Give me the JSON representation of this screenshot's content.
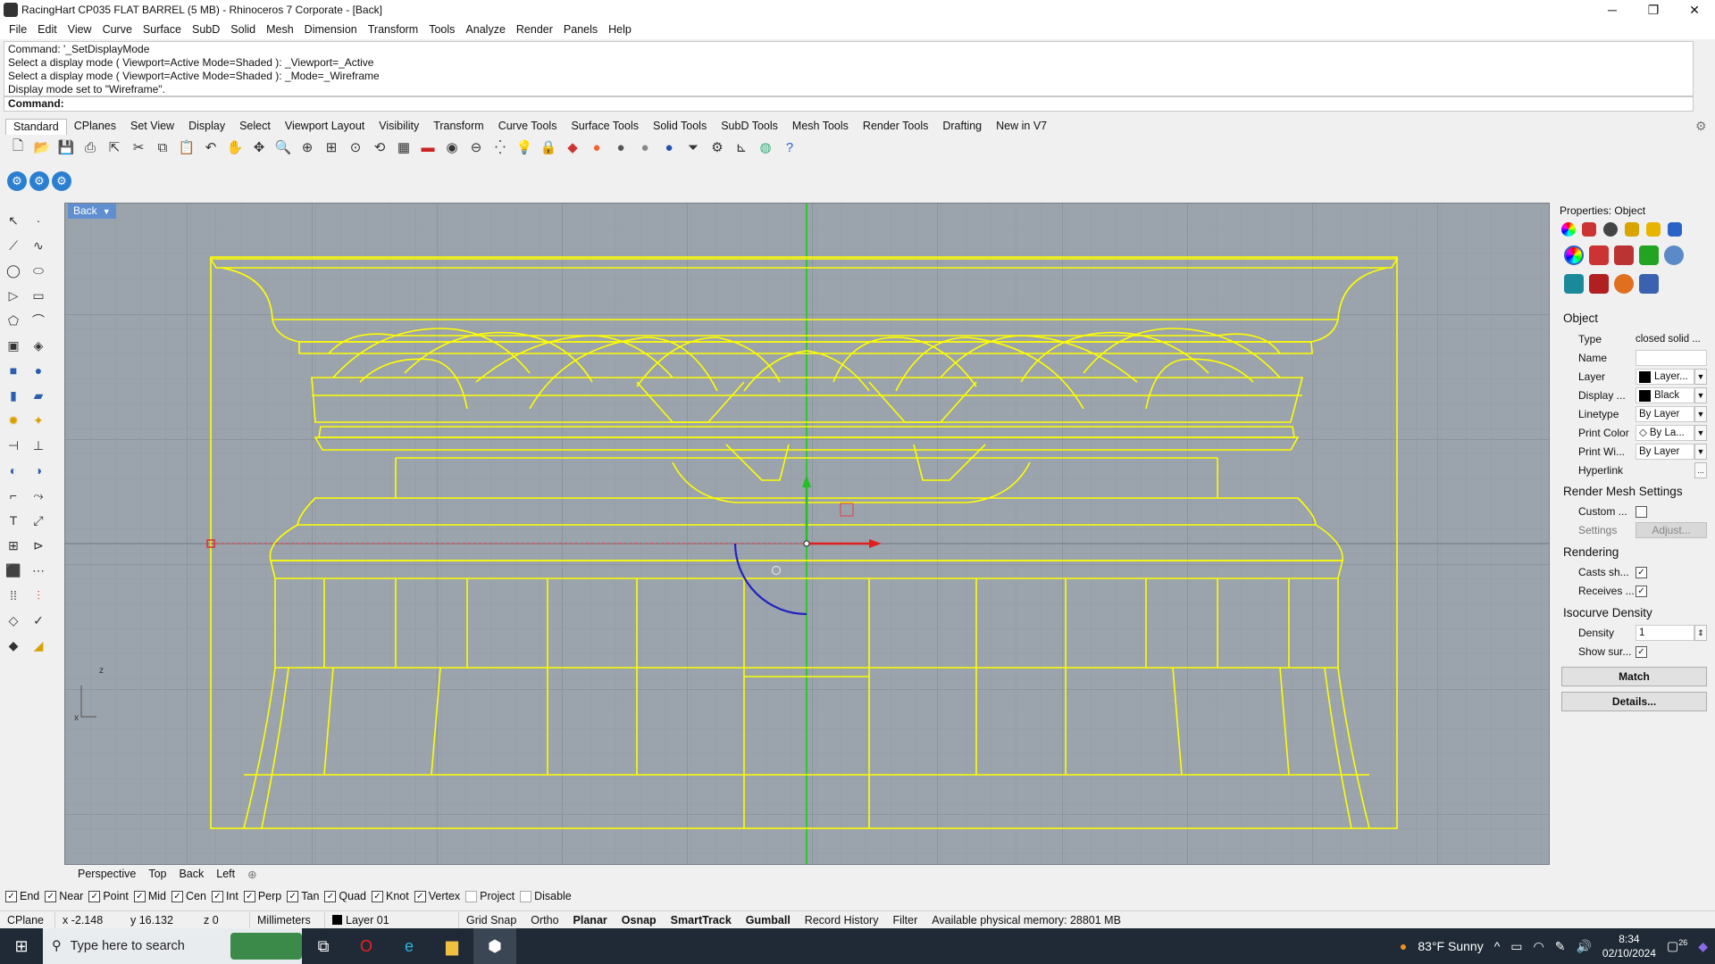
{
  "window": {
    "title": "RacingHart CP035 FLAT BARREL (5 MB) - Rhinoceros 7 Corporate - [Back]"
  },
  "menu": [
    "File",
    "Edit",
    "View",
    "Curve",
    "Surface",
    "SubD",
    "Solid",
    "Mesh",
    "Dimension",
    "Transform",
    "Tools",
    "Analyze",
    "Render",
    "Panels",
    "Help"
  ],
  "command_history": [
    "Command: '_SetDisplayMode",
    "Select a display mode ( Viewport=Active  Mode=Shaded ): _Viewport=_Active",
    "Select a display mode ( Viewport=Active  Mode=Shaded ): _Mode=_Wireframe",
    "Display mode set to \"Wireframe\"."
  ],
  "command_prompt": "Command:",
  "toolbar_tabs": [
    "Standard",
    "CPlanes",
    "Set View",
    "Display",
    "Select",
    "Viewport Layout",
    "Visibility",
    "Transform",
    "Curve Tools",
    "Surface Tools",
    "Solid Tools",
    "SubD Tools",
    "Mesh Tools",
    "Render Tools",
    "Drafting",
    "New in V7"
  ],
  "active_tab": "Standard",
  "viewport": {
    "label": "Back",
    "tabs": [
      "Perspective",
      "Top",
      "Back",
      "Left"
    ],
    "axis_z": "z",
    "axis_x": "x"
  },
  "properties": {
    "title": "Properties: Object",
    "section_object": "Object",
    "type_label": "Type",
    "type_value": "closed solid ...",
    "name_label": "Name",
    "name_value": "",
    "layer_label": "Layer",
    "layer_value": "Layer...",
    "display_label": "Display ...",
    "display_value": "Black",
    "linetype_label": "Linetype",
    "linetype_value": "By Layer",
    "printcolor_label": "Print Color",
    "printcolor_value": "By La...",
    "printwidth_label": "Print Wi...",
    "printwidth_value": "By Layer",
    "hyperlink_label": "Hyperlink",
    "hyperlink_value": "...",
    "section_mesh": "Render Mesh Settings",
    "custom_label": "Custom ...",
    "settings_label": "Settings",
    "adjust_button": "Adjust...",
    "section_rendering": "Rendering",
    "casts_label": "Casts sh...",
    "receives_label": "Receives ...",
    "section_isocurve": "Isocurve Density",
    "density_label": "Density",
    "density_value": "1",
    "showsur_label": "Show sur...",
    "match_button": "Match",
    "details_button": "Details..."
  },
  "osnap": [
    {
      "label": "End",
      "checked": true
    },
    {
      "label": "Near",
      "checked": true
    },
    {
      "label": "Point",
      "checked": true
    },
    {
      "label": "Mid",
      "checked": true
    },
    {
      "label": "Cen",
      "checked": true
    },
    {
      "label": "Int",
      "checked": true
    },
    {
      "label": "Perp",
      "checked": true
    },
    {
      "label": "Tan",
      "checked": true
    },
    {
      "label": "Quad",
      "checked": true
    },
    {
      "label": "Knot",
      "checked": true
    },
    {
      "label": "Vertex",
      "checked": true
    },
    {
      "label": "Project",
      "checked": false
    },
    {
      "label": "Disable",
      "checked": false
    }
  ],
  "status": {
    "cplane": "CPlane",
    "x": "x -2.148",
    "y": "y 16.132",
    "z": "z 0",
    "units": "Millimeters",
    "layer": "Layer 01",
    "grid_snap": "Grid Snap",
    "ortho": "Ortho",
    "planar": "Planar",
    "osnap": "Osnap",
    "smarttrack": "SmartTrack",
    "gumball": "Gumball",
    "record_history": "Record History",
    "filter": "Filter",
    "memory": "Available physical memory: 28801 MB"
  },
  "taskbar": {
    "search_placeholder": "Type here to search",
    "weather": "83°F  Sunny",
    "time": "8:34",
    "date": "02/10/2024",
    "notif_count": "26"
  },
  "colors": {
    "wire": "#ffff00",
    "viewport_bg": "#9ba3ac",
    "active_label": "#5f8fd0"
  }
}
